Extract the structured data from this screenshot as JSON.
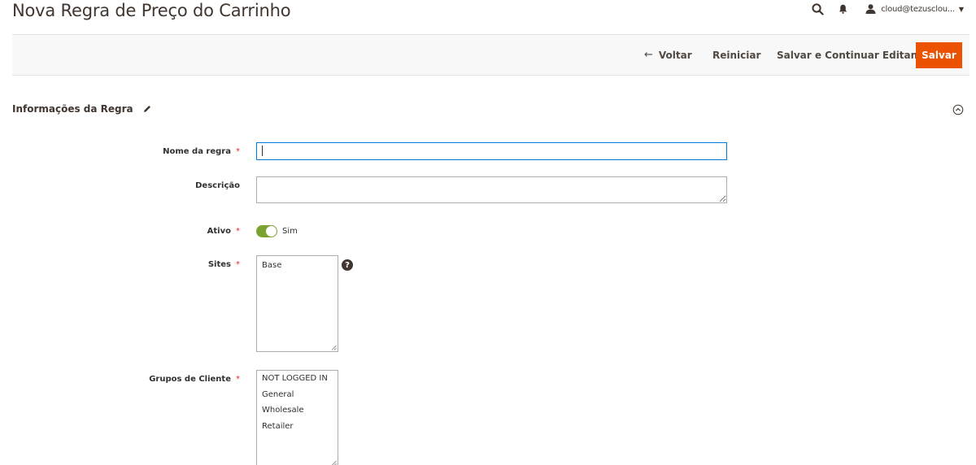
{
  "header": {
    "title": "Nova Regra de Preço do Carrinho",
    "user_name": "cloud@tezusclou...",
    "icons": [
      "search-icon",
      "bell-icon",
      "user-icon",
      "caret-down-icon"
    ]
  },
  "toolbar": {
    "back_label": "Voltar",
    "back_arrow": "←",
    "reset_label": "Reiniciar",
    "save_continue_label": "Salvar e Continuar Editando",
    "save_label": "Salvar",
    "save_color": "#eb5202"
  },
  "section": {
    "title": "Informações da Regra"
  },
  "form": {
    "required_marker": "*",
    "nome": {
      "label": "Nome da regra",
      "value": ""
    },
    "descricao": {
      "label": "Descrição",
      "value": ""
    },
    "ativo": {
      "label": "Ativo",
      "value_label": "Sim",
      "on": true,
      "toggle_color": "#79a22e"
    },
    "sites": {
      "label": "Sites",
      "help": "?",
      "options": [
        "Base"
      ]
    },
    "grupos": {
      "label": "Grupos de Cliente",
      "options": [
        "NOT LOGGED IN",
        "General",
        "Wholesale",
        "Retailer"
      ]
    }
  }
}
